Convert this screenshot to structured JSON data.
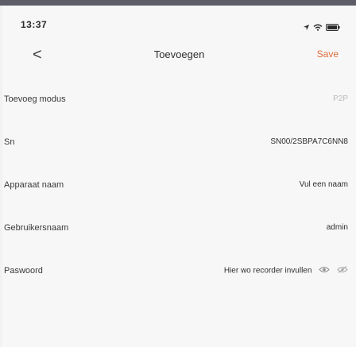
{
  "status_bar": {
    "time": "13:37",
    "icons": [
      "location-arrow-icon",
      "wifi-icon",
      "battery-icon"
    ]
  },
  "nav": {
    "back_label": "<",
    "title": "Toevoegen",
    "save_label": "Save"
  },
  "form": {
    "rows": [
      {
        "label": "Toevoeg modus",
        "value": "P2P"
      },
      {
        "label": "Sn",
        "value": "SN00/2SBPA7C6NN8"
      },
      {
        "label": "Apparaat naam",
        "value": "Vul een naam"
      },
      {
        "label": "Gebruikersnaam",
        "value": "admin"
      },
      {
        "label": "Paswoord",
        "value": "Hier wo recorder invullen"
      }
    ]
  },
  "colors": {
    "accent": "#e06a3a",
    "muted_value": "#b9b9b9"
  }
}
